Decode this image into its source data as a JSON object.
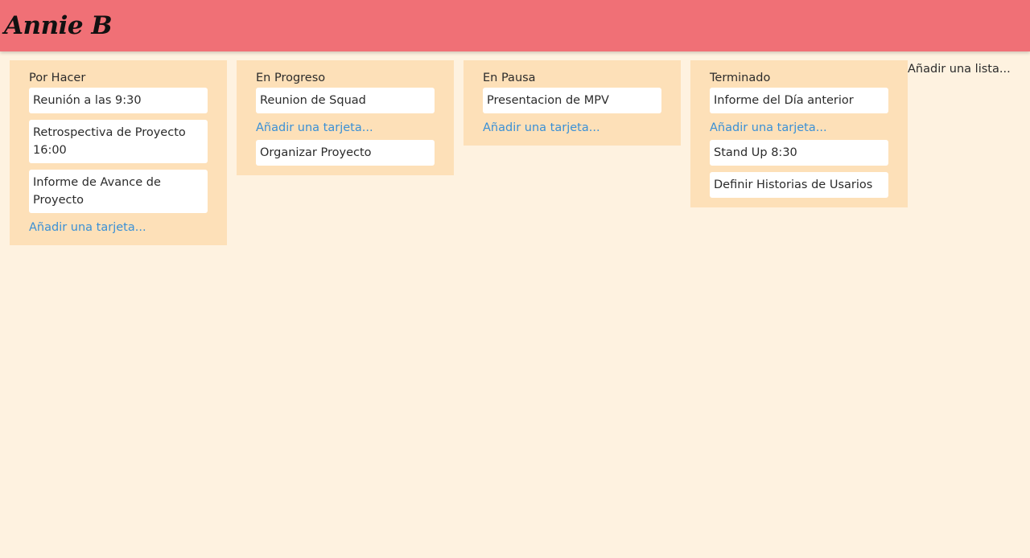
{
  "header": {
    "logo": "Annie B",
    "color": "#f07076"
  },
  "colors": {
    "background": "#fef2e0",
    "list_background": "#fde0b8",
    "link": "#3a90d6"
  },
  "lists": [
    {
      "title": "Por Hacer",
      "cards": [
        "Reunión a las 9:30",
        "Retrospectiva de Proyecto 16:00",
        "Informe de Avance de Proyecto"
      ],
      "add_card": "Añadir una tarjeta..."
    },
    {
      "title": "En Progreso",
      "cards": [
        "Reunion de Squad",
        "Organizar Proyecto"
      ],
      "add_card": "Añadir una tarjeta..."
    },
    {
      "title": "En Pausa",
      "cards": [
        "Presentacion de MPV"
      ],
      "add_card": "Añadir una tarjeta..."
    },
    {
      "title": "Terminado",
      "cards": [
        "Informe del Día anterior",
        "Stand Up 8:30",
        "Definir Historias de Usarios"
      ],
      "add_card": "Añadir una tarjeta..."
    }
  ],
  "add_list": "Añadir una lista..."
}
